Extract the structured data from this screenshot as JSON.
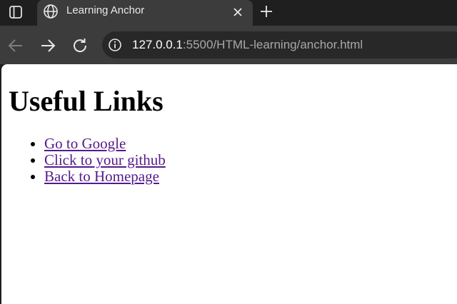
{
  "tab": {
    "title": "Learning Anchor",
    "favicon": "globe-icon"
  },
  "toolbar": {
    "url_host": "127.0.0.1",
    "url_path": ":5500/HTML-learning/anchor.html"
  },
  "page": {
    "heading": "Useful Links",
    "links": [
      "Go to Google",
      "Click to your github",
      "Back to Homepage"
    ]
  },
  "colors": {
    "tabbar_bg": "#1f1f1f",
    "toolbar_bg": "#3c3c3c",
    "omnibox_bg": "#282828",
    "link_visited": "#551a8b"
  }
}
